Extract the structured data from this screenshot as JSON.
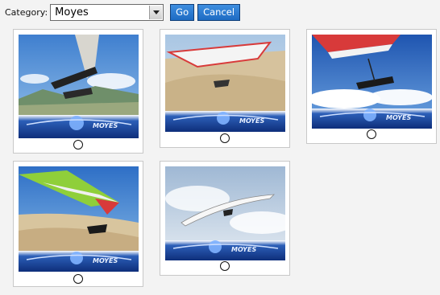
{
  "toolbar": {
    "category_label": "Category:",
    "category_value": "Moyes",
    "go_label": "Go",
    "cancel_label": "Cancel"
  },
  "gallery": {
    "logo_text": "MOYES",
    "items": [
      {
        "scene": "mountain",
        "selected": false
      },
      {
        "scene": "dune",
        "selected": false
      },
      {
        "scene": "clouds",
        "selected": false
      },
      {
        "scene": "desert",
        "selected": false
      },
      {
        "scene": "overcast",
        "selected": false
      }
    ]
  },
  "colors": {
    "button_bg": "#2a78cf",
    "logo_band": "#14378a",
    "sail_red": "#d83a3a"
  }
}
